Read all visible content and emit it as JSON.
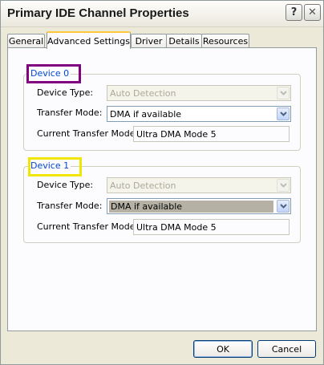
{
  "window": {
    "title": "Primary IDE Channel Properties",
    "help_glyph": "?",
    "close_glyph": "✕"
  },
  "tabs": [
    {
      "label": "General"
    },
    {
      "label": "Advanced Settings"
    },
    {
      "label": "Driver"
    },
    {
      "label": "Details"
    },
    {
      "label": "Resources"
    }
  ],
  "devices": [
    {
      "legend": "Device 0",
      "highlight_color": "#800080",
      "device_type_label": "Device Type:",
      "device_type_value": "Auto Detection",
      "transfer_mode_label": "Transfer Mode:",
      "transfer_mode_value": "DMA if available",
      "current_mode_label": "Current Transfer Mode:",
      "current_mode_value": "Ultra DMA Mode 5"
    },
    {
      "legend": "Device 1",
      "highlight_color": "#f0e600",
      "device_type_label": "Device Type:",
      "device_type_value": "Auto Detection",
      "transfer_mode_label": "Transfer Mode:",
      "transfer_mode_value": "DMA if available",
      "current_mode_label": "Current Transfer Mode:",
      "current_mode_value": "Ultra DMA Mode 5"
    }
  ],
  "buttons": {
    "ok": "OK",
    "cancel": "Cancel"
  },
  "icons": {
    "dropdown": "chevron-down-icon"
  }
}
